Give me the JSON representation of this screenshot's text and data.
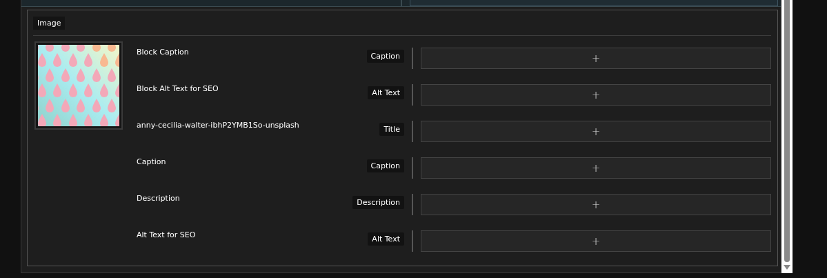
{
  "section": {
    "title": "Image"
  },
  "fields": [
    {
      "label": "Block Caption",
      "tag": "Caption",
      "action": "+"
    },
    {
      "label": "Block Alt Text for SEO",
      "tag": "Alt Text",
      "action": "+"
    },
    {
      "label": "anny-cecilia-walter-ibhP2YMB1So-unsplash",
      "tag": "Title",
      "action": "+"
    },
    {
      "label": "Caption",
      "tag": "Caption",
      "action": "+"
    },
    {
      "label": "Description",
      "tag": "Description",
      "action": "+"
    },
    {
      "label": "Alt Text for SEO",
      "tag": "Alt Text",
      "action": "+"
    }
  ]
}
